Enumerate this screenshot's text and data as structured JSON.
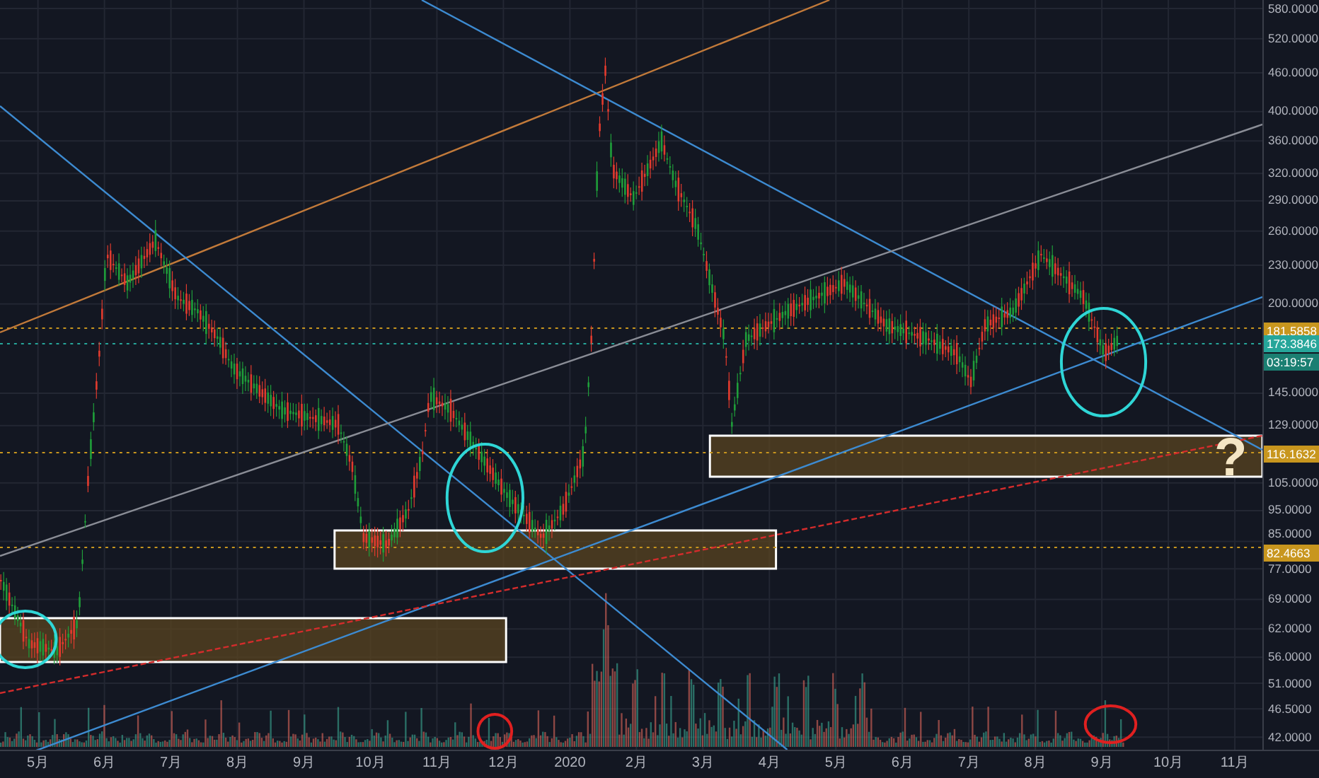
{
  "price_axis": {
    "labels": [
      "580.0000",
      "520.0000",
      "460.0000",
      "400.0000",
      "360.0000",
      "320.0000",
      "290.0000",
      "260.0000",
      "230.0000",
      "200.0000",
      "145.0000",
      "129.0000",
      "105.0000",
      "95.0000",
      "85.0000",
      "77.0000",
      "69.0000",
      "62.0000",
      "56.0000",
      "51.0000",
      "46.5000",
      "42.0000"
    ]
  },
  "price_tags": [
    {
      "kind": "price",
      "text": "181.5858",
      "color": "#c8961e"
    },
    {
      "kind": "price",
      "text": "173.3846",
      "color": "#26a69a"
    },
    {
      "kind": "countdown",
      "text": "03:19:57",
      "color": "#1b7f72"
    },
    {
      "kind": "price",
      "text": "116.1632",
      "color": "#c8961e"
    },
    {
      "kind": "price",
      "text": "82.4663",
      "color": "#c8961e"
    }
  ],
  "time_axis": {
    "labels": [
      "5月",
      "6月",
      "7月",
      "8月",
      "9月",
      "10月",
      "11月",
      "12月",
      "2020",
      "2月",
      "3月",
      "4月",
      "5月",
      "6月",
      "7月",
      "8月",
      "9月",
      "10月",
      "11月"
    ]
  },
  "annotations": [
    {
      "kind": "question",
      "text": "?"
    }
  ]
}
